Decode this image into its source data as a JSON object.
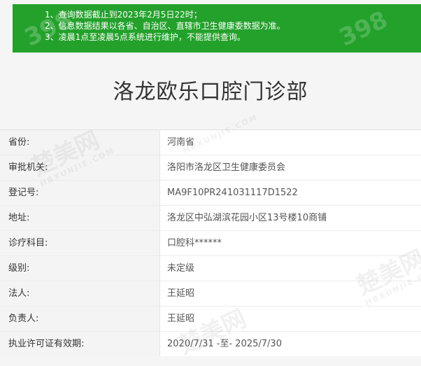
{
  "notice": {
    "lines": [
      "1、查询数据截止到2023年2月5日22时；",
      "2、信息数据结果以各省、自治区、直辖市卫生健康委数据为准。",
      "3、凌晨1点至凌晨5点系统进行维护，不能提供查询。"
    ]
  },
  "title": "洛龙欧乐口腔门诊部",
  "rows": [
    {
      "label": "省份:",
      "value": "河南省"
    },
    {
      "label": "审批机关:",
      "value": "洛阳市洛龙区卫生健康委员会"
    },
    {
      "label": "登记号:",
      "value": "MA9F10PR241031117D1522"
    },
    {
      "label": "地址:",
      "value": "洛龙区中弘湖滨花园小区13号楼10商铺"
    },
    {
      "label": "诊疗科目:",
      "value": "口腔科******"
    },
    {
      "label": "级别:",
      "value": "未定级"
    },
    {
      "label": "法人:",
      "value": "王延昭"
    },
    {
      "label": "负责人:",
      "value": "王延昭"
    },
    {
      "label": "执业许可证有效期:",
      "value": "2020/7/31 -至- 2025/7/30"
    }
  ],
  "watermarks": {
    "brand": "楚美网",
    "domain": "HBXUNJIE.COM",
    "logo": "398"
  }
}
